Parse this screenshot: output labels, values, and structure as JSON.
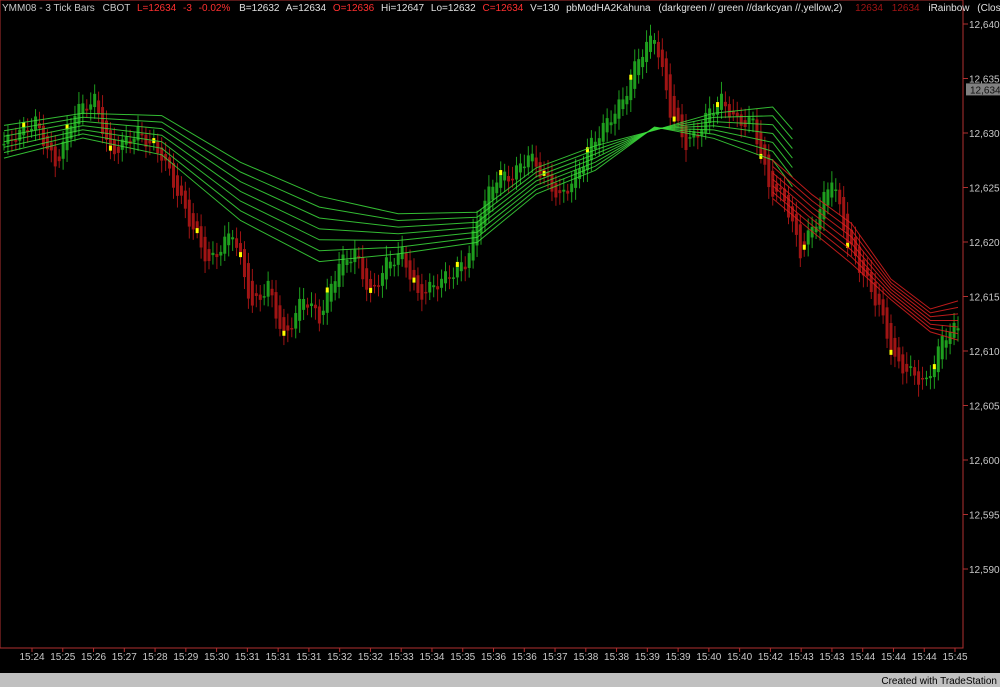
{
  "header": {
    "symbol": "YMM08 - 3 Tick Bars",
    "exchange": "CBOT",
    "last": "L=12634",
    "change": "-3",
    "change_pct": "-0.02%",
    "bid": "B=12632",
    "ask": "A=12634",
    "open": "O=12636",
    "high": "Hi=12647",
    "low": "Lo=12632",
    "close": "C=12634",
    "volume": "V=130",
    "indicator1": "pbModHA2Kahuna",
    "indicator1_params": "(darkgreen // green //darkcyan //,yellow,2)",
    "ind_val1": "12634",
    "ind_val2": "12634",
    "indicator2": "iRainbow",
    "indicator2_params": "(Close,8,1,8,Close,73 // 178,..."
  },
  "footer": {
    "credit": "Created with TradeStation"
  },
  "colors": {
    "background": "#000000",
    "frame": "#b03030",
    "up_bar": "#1e9e1e",
    "down_bar": "#a01414",
    "highlight": "#ffff00",
    "rainbow_green": "#3cdc3c",
    "rainbow_red": "#dc2020",
    "last_price_box": "#808080"
  },
  "chart_data": {
    "type": "line",
    "title": "YMM08 - 3 Tick Bars",
    "y_ticks": [
      "12,640",
      "12,635",
      "12,630",
      "12,625",
      "12,620",
      "12,615",
      "12,610",
      "12,605",
      "12,600",
      "12,595",
      "12,590"
    ],
    "y_tick_values": [
      12640,
      12635,
      12630,
      12625,
      12620,
      12615,
      12610,
      12605,
      12600,
      12595,
      12590
    ],
    "ylim": [
      12586,
      12641
    ],
    "last_price_label": "12,634",
    "last_price": 12634,
    "x_labels": [
      "15:24",
      "15:25",
      "15:26",
      "15:27",
      "15:28",
      "15:29",
      "15:30",
      "15:31",
      "15:31",
      "15:31",
      "15:32",
      "15:32",
      "15:33",
      "15:34",
      "15:35",
      "15:36",
      "15:36",
      "15:37",
      "15:38",
      "15:38",
      "15:39",
      "15:39",
      "15:40",
      "15:40",
      "15:42",
      "15:43",
      "15:43",
      "15:44",
      "15:44",
      "15:44",
      "15:45"
    ],
    "x_count": 190,
    "price_path": [
      [
        0,
        12629
      ],
      [
        8,
        12631
      ],
      [
        13,
        12627
      ],
      [
        18,
        12632
      ],
      [
        23,
        12633
      ],
      [
        27,
        12628
      ],
      [
        30,
        12629
      ],
      [
        34,
        12630
      ],
      [
        40,
        12628
      ],
      [
        47,
        12622
      ],
      [
        52,
        12618
      ],
      [
        58,
        12621
      ],
      [
        63,
        12614
      ],
      [
        67,
        12616
      ],
      [
        71,
        12611
      ],
      [
        76,
        12615
      ],
      [
        80,
        12613
      ],
      [
        85,
        12618
      ],
      [
        89,
        12619
      ],
      [
        93,
        12615
      ],
      [
        97,
        12618
      ],
      [
        101,
        12619
      ],
      [
        105,
        12615
      ],
      [
        109,
        12616
      ],
      [
        113,
        12617
      ],
      [
        117,
        12618
      ],
      [
        121,
        12623
      ],
      [
        125,
        12626
      ],
      [
        129,
        12626
      ],
      [
        133,
        12628
      ],
      [
        137,
        12626
      ],
      [
        141,
        12624
      ],
      [
        145,
        12626
      ],
      [
        149,
        12629
      ],
      [
        153,
        12631
      ],
      [
        157,
        12633
      ],
      [
        161,
        12637
      ],
      [
        165,
        12639
      ],
      [
        169,
        12632
      ],
      [
        173,
        12629
      ],
      [
        176,
        12630
      ],
      [
        179,
        12632
      ],
      [
        182,
        12633
      ],
      [
        186,
        12631
      ],
      [
        190,
        12631
      ],
      [
        194,
        12625
      ],
      [
        198,
        12624
      ],
      [
        202,
        12619
      ],
      [
        206,
        12622
      ],
      [
        210,
        12626
      ],
      [
        214,
        12620
      ],
      [
        218,
        12617
      ],
      [
        222,
        12614
      ],
      [
        226,
        12609
      ],
      [
        230,
        12608
      ],
      [
        234,
        12607
      ],
      [
        238,
        12611
      ],
      [
        240,
        12612
      ]
    ],
    "ribbon_green": [
      [
        0,
        12627
      ],
      [
        20,
        12628
      ],
      [
        40,
        12628
      ],
      [
        60,
        12624
      ],
      [
        80,
        12621
      ],
      [
        100,
        12619
      ],
      [
        120,
        12619
      ],
      [
        135,
        12623
      ],
      [
        150,
        12625
      ],
      [
        165,
        12626
      ],
      [
        180,
        12628
      ],
      [
        195,
        12629
      ],
      [
        200,
        12627
      ]
    ],
    "ribbon_red": [
      [
        195,
        12629
      ],
      [
        205,
        12626
      ],
      [
        215,
        12623
      ],
      [
        225,
        12620
      ],
      [
        235,
        12617
      ],
      [
        242,
        12616
      ]
    ],
    "x_max": 242,
    "grid": false,
    "legend": "none"
  }
}
